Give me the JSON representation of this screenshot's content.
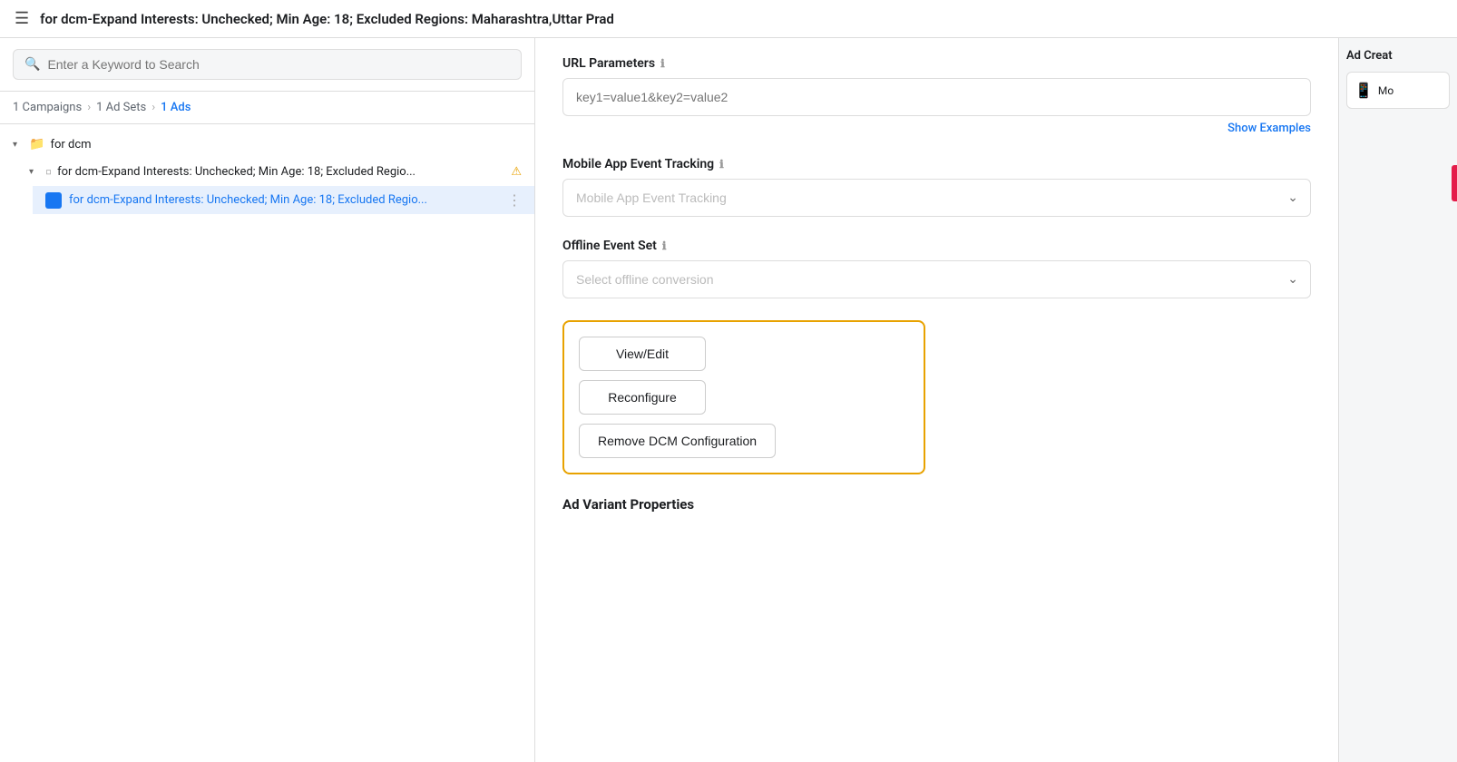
{
  "titleBar": {
    "icon": "☰",
    "text": "for dcm-Expand Interests: Unchecked; Min Age: 18; Excluded Regions: Maharashtra,Uttar Prad"
  },
  "sidebar": {
    "searchPlaceholder": "Enter a Keyword to Search",
    "breadcrumb": {
      "campaigns": "1 Campaigns",
      "adSets": "1 Ad Sets",
      "ads": "1 Ads"
    },
    "tree": {
      "campaign": {
        "label": "for dcm",
        "icon": "📁",
        "adSet": {
          "label": "for dcm-Expand Interests: Unchecked; Min Age: 18; Excluded Regio...",
          "hasWarning": true,
          "ad": {
            "label": "for dcm-Expand Interests: Unchecked; Min Age: 18; Excluded Regio...",
            "selected": true
          }
        }
      }
    }
  },
  "center": {
    "urlParameters": {
      "label": "URL Parameters",
      "placeholder": "key1=value1&key2=value2",
      "showExamples": "Show Examples"
    },
    "mobileAppEventTracking": {
      "label": "Mobile App Event Tracking",
      "selectPlaceholder": "Mobile App Event Tracking"
    },
    "offlineEventSet": {
      "label": "Offline Event Set",
      "selectPlaceholder": "Select offline conversion"
    },
    "dcmButtons": {
      "viewEdit": "View/Edit",
      "reconfigure": "Reconfigure",
      "removeDCM": "Remove DCM Configuration"
    },
    "adVariantProperties": {
      "title": "Ad Variant Properties"
    }
  },
  "rightPanel": {
    "title": "Ad Creat",
    "item": {
      "icon": "📱",
      "label": "Mo"
    }
  },
  "icons": {
    "search": "🔍",
    "chevronRight": "›",
    "chevronDown": "▾",
    "chevronUp": "▴",
    "info": "ℹ",
    "warning": "⚠",
    "menu": "⋮",
    "folder": "📁",
    "adIcon": "▪",
    "adSetIcon": "▫",
    "selectChevron": "⌄",
    "mobile": "📱"
  }
}
